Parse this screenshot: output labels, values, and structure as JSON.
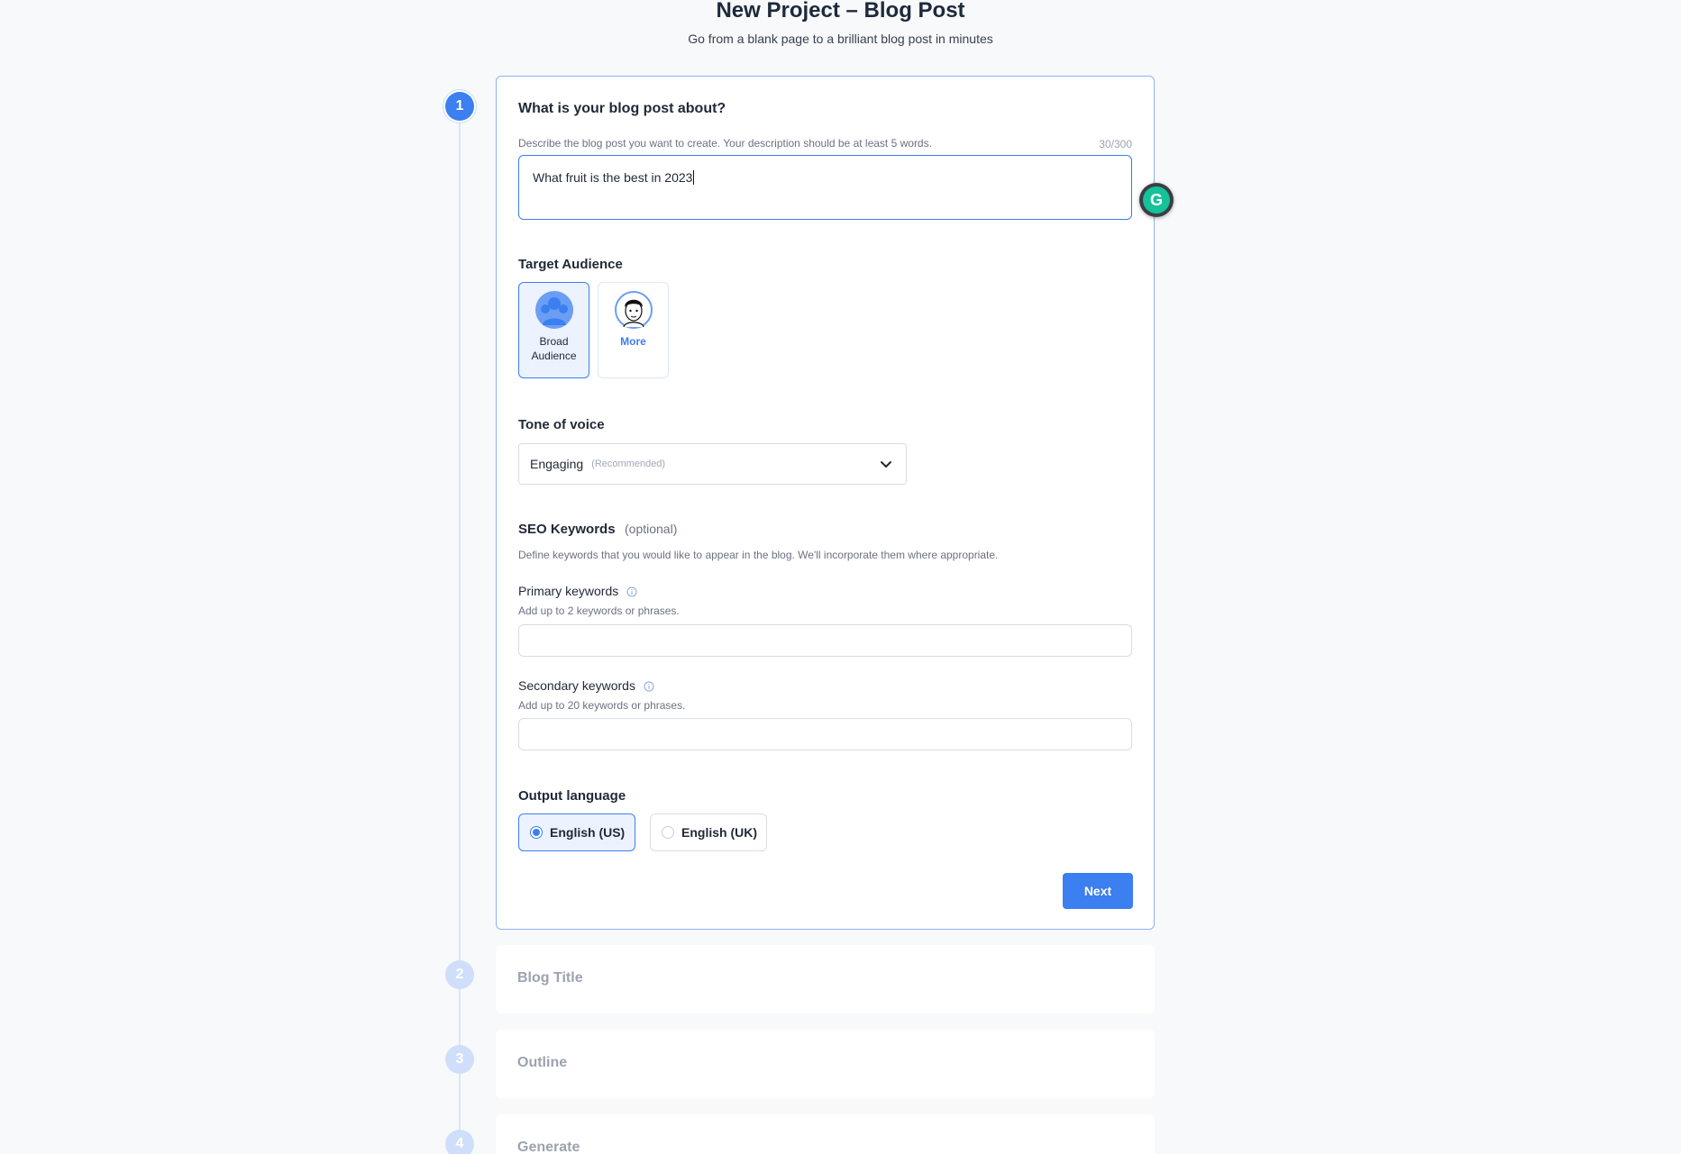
{
  "header": {
    "title": "New Project – Blog Post",
    "subtitle": "Go from a blank page to a brilliant blog post in minutes"
  },
  "steps": [
    {
      "number": "1",
      "title": "What is your blog post about?"
    },
    {
      "number": "2",
      "title": "Blog Title"
    },
    {
      "number": "3",
      "title": "Outline"
    },
    {
      "number": "4",
      "title": "Generate"
    }
  ],
  "topic": {
    "help": "Describe the blog post you want to create. Your description should be at least 5 words.",
    "counter": "30/300",
    "value": "What fruit is the best in 2023"
  },
  "audience": {
    "label": "Target Audience",
    "options": [
      {
        "label": "Broad Audience",
        "selected": true
      },
      {
        "label": "More",
        "selected": false
      }
    ]
  },
  "tone": {
    "label": "Tone of voice",
    "value": "Engaging",
    "hint": "(Recommended)"
  },
  "seo": {
    "label": "SEO Keywords",
    "optional": "(optional)",
    "help": "Define keywords that you would like to appear in the blog. We'll incorporate them where appropriate.",
    "primary_label": "Primary keywords",
    "primary_help": "Add up to 2 keywords or phrases.",
    "primary_value": "",
    "secondary_label": "Secondary keywords",
    "secondary_help": "Add up to 20 keywords or phrases.",
    "secondary_value": ""
  },
  "language": {
    "label": "Output language",
    "options": [
      {
        "label": "English (US)",
        "selected": true
      },
      {
        "label": "English (UK)",
        "selected": false
      }
    ]
  },
  "actions": {
    "next_label": "Next"
  },
  "colors": {
    "accent": "#3b7ff0",
    "grammarly": "#15c39a"
  }
}
